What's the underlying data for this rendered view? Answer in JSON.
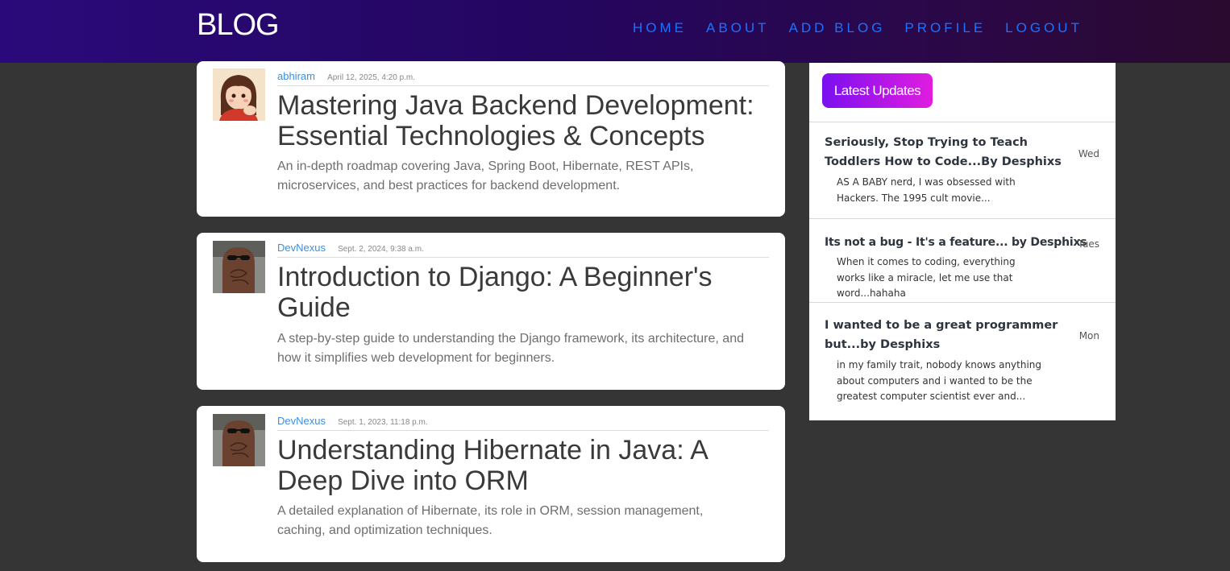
{
  "navbar": {
    "brand": "BLOG",
    "links": [
      "HOME",
      "ABOUT",
      "ADD BLOG",
      "PROFILE",
      "LOGOUT"
    ]
  },
  "posts": [
    {
      "author": "abhiram",
      "date": "April 12, 2025, 4:20 p.m.",
      "title": "Mastering Java Backend Development: Essential Technologies & Concepts",
      "description": "An in-depth roadmap covering Java, Spring Boot, Hibernate, REST APIs, microservices, and best practices for backend development.",
      "avatar_icon": "cartoon-girl-avatar"
    },
    {
      "author": "DevNexus",
      "date": "Sept. 2, 2024, 9:38 a.m.",
      "title": "Introduction to Django: A Beginner's Guide",
      "description": "A step-by-step guide to understanding the Django framework, its architecture, and how it simplifies web development for beginners.",
      "avatar_icon": "sunglasses-cat-avatar"
    },
    {
      "author": "DevNexus",
      "date": "Sept. 1, 2023, 11:18 p.m.",
      "title": "Understanding Hibernate in Java: A Deep Dive into ORM",
      "description": "A detailed explanation of Hibernate, its role in ORM, session management, caching, and optimization techniques.",
      "avatar_icon": "sunglasses-cat-avatar"
    }
  ],
  "sidebar": {
    "badge": "Latest Updates",
    "items": [
      {
        "title": "Seriously, Stop Trying to Teach Toddlers How to Code...By Desphixs",
        "day": "Wed",
        "excerpt": "AS A BABY nerd, I was obsessed with Hackers. The 1995 cult movie..."
      },
      {
        "title": "Its not a bug - It's a feature... by Desphixs",
        "day": "Tues",
        "excerpt": "When it comes to coding, everything works like a miracle, let me use that word...hahaha"
      },
      {
        "title": "I wanted to be a great programmer but...by Desphixs",
        "day": "Mon",
        "excerpt": "in my family trait, nobody knows anything about computers and i wanted to be the greatest computer scientist ever and..."
      }
    ]
  },
  "colors": {
    "page_background": "#353535",
    "nav_link": "#1a73ff",
    "author_link": "#3d8fe0",
    "badge_gradient_start": "#7a0ff0",
    "badge_gradient_end": "#e11de0"
  }
}
